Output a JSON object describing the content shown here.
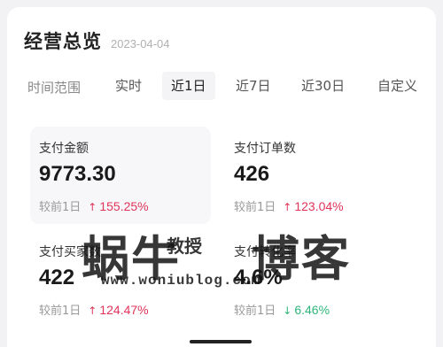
{
  "header": {
    "title": "经营总览",
    "date": "2023-04-04"
  },
  "tabs": {
    "label": "时间范围",
    "items": [
      "实时",
      "近1日",
      "近7日",
      "近30日",
      "自定义"
    ],
    "active_index": 1
  },
  "metrics": [
    {
      "label": "支付金额",
      "value": "9773.30",
      "compare_label": "较前1日",
      "direction": "up",
      "change": "155.25%"
    },
    {
      "label": "支付订单数",
      "value": "426",
      "compare_label": "较前1日",
      "direction": "up",
      "change": "123.04%"
    },
    {
      "label": "支付买家数",
      "value": "422",
      "compare_label": "较前1日",
      "direction": "up",
      "change": "124.47%"
    },
    {
      "label": "支付转化率",
      "value": "4.6%",
      "compare_label": "较前1日",
      "direction": "down",
      "change": "6.46%"
    }
  ],
  "watermark": {
    "left": "蜗牛",
    "middle": "教授",
    "right": "博客",
    "url": "www.woniublog.com"
  },
  "colors": {
    "up": "#e0345a",
    "down": "#2fb57b",
    "active_tab_bg": "#f4f4f6"
  }
}
